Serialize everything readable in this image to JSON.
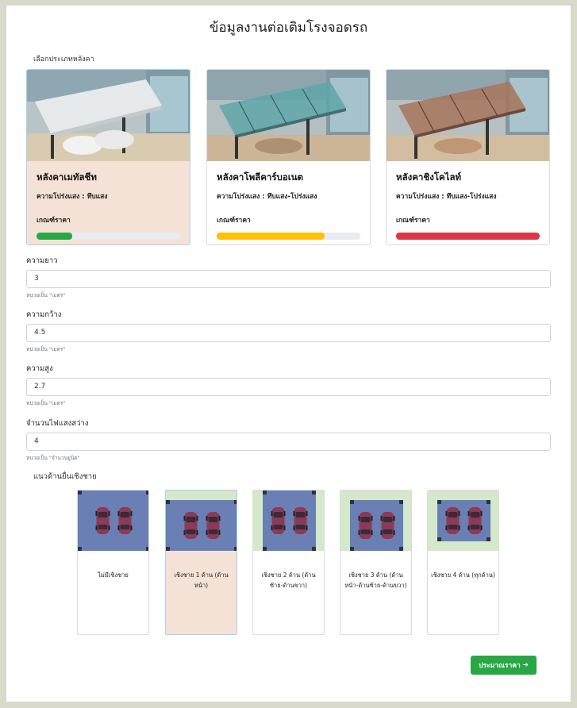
{
  "page": {
    "title": "ข้อมูลงานต่อเติมโรงจอดรถ"
  },
  "roof_section": {
    "label": "เลือกประเภทหลังคา",
    "cards": [
      {
        "name": "หลังคาเมทัลชีท",
        "transparency": "ความโปร่งแสง : ทึบแสง",
        "price_label": "เกณฑ์ราคา",
        "price_level": 0.25,
        "bar_color": "#28a745",
        "selected": true
      },
      {
        "name": "หลังคาโพลีคาร์บอเนต",
        "transparency": "ความโปร่งแสง : ทึบแสง-โปร่งแสง",
        "price_label": "เกณฑ์ราคา",
        "price_level": 0.75,
        "bar_color": "#ffc107",
        "selected": false
      },
      {
        "name": "หลังคาชิงโคไลท์",
        "transparency": "ความโปร่งแสง : ทึบแสง-โปร่งแสง",
        "price_label": "เกณฑ์ราคา",
        "price_level": 1.0,
        "bar_color": "#dc3545",
        "selected": false
      }
    ]
  },
  "fields": {
    "length": {
      "label": "ความยาว",
      "value": "3",
      "help": "หน่วยเป็น \"เมตร\""
    },
    "width": {
      "label": "ความกว้าง",
      "value": "4.5",
      "help": "หน่วยเป็น \"เมตร\""
    },
    "height": {
      "label": "ความสูง",
      "value": "2.7",
      "help": "หน่วยเป็น \"เมตร\""
    },
    "lights": {
      "label": "จำนวนไฟแสงสว่าง",
      "value": "4",
      "help": "หน่วยเป็น \"จำนวนยูนิต\""
    }
  },
  "eaves_section": {
    "label": "แนวด้านยื่นเชิงชาย",
    "options": [
      {
        "text": "ไม่มีเชิงชาย",
        "sides": 0,
        "selected": false
      },
      {
        "text": "เชิงชาย 1 ด้าน (ด้านหน้า)",
        "sides": 1,
        "selected": true
      },
      {
        "text": "เชิงชาย 2 ด้าน (ด้านซ้าย-ด้านขวา)",
        "sides": 2,
        "selected": false
      },
      {
        "text": "เชิงชาย 3 ด้าน (ด้านหน้า-ด้านซ้าย-ด้านขวา)",
        "sides": 3,
        "selected": false
      },
      {
        "text": "เชิงชาย 4 ด้าน (ทุกด้าน)",
        "sides": 4,
        "selected": false
      }
    ]
  },
  "actions": {
    "estimate_label": "ประมาณราคา",
    "estimate_icon": "arrow-right-icon"
  },
  "colors": {
    "primary_green": "#28a745",
    "selected_bg": "#f5e2d6",
    "eave_green": "#d4e8cc",
    "roof_blue": "#6a7fb4"
  }
}
